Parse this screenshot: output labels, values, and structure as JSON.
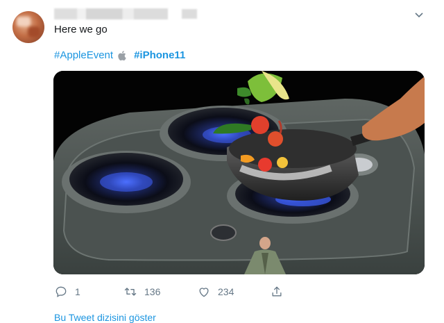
{
  "tweet": {
    "text": "Here we go",
    "hashtags": [
      "#AppleEvent",
      "#iPhone11"
    ],
    "icons": {
      "menu": "chevron-down-icon",
      "apple": "apple-logo-icon",
      "reply": "reply-icon",
      "retweet": "retweet-icon",
      "like": "heart-icon",
      "share": "share-icon"
    },
    "actions": {
      "reply_count": "1",
      "retweet_count": "136",
      "like_count": "234"
    },
    "show_thread_label": "Bu Tweet dizisini göster"
  },
  "colors": {
    "link": "#1b95e0",
    "text": "#14171a",
    "muted": "#657786"
  }
}
